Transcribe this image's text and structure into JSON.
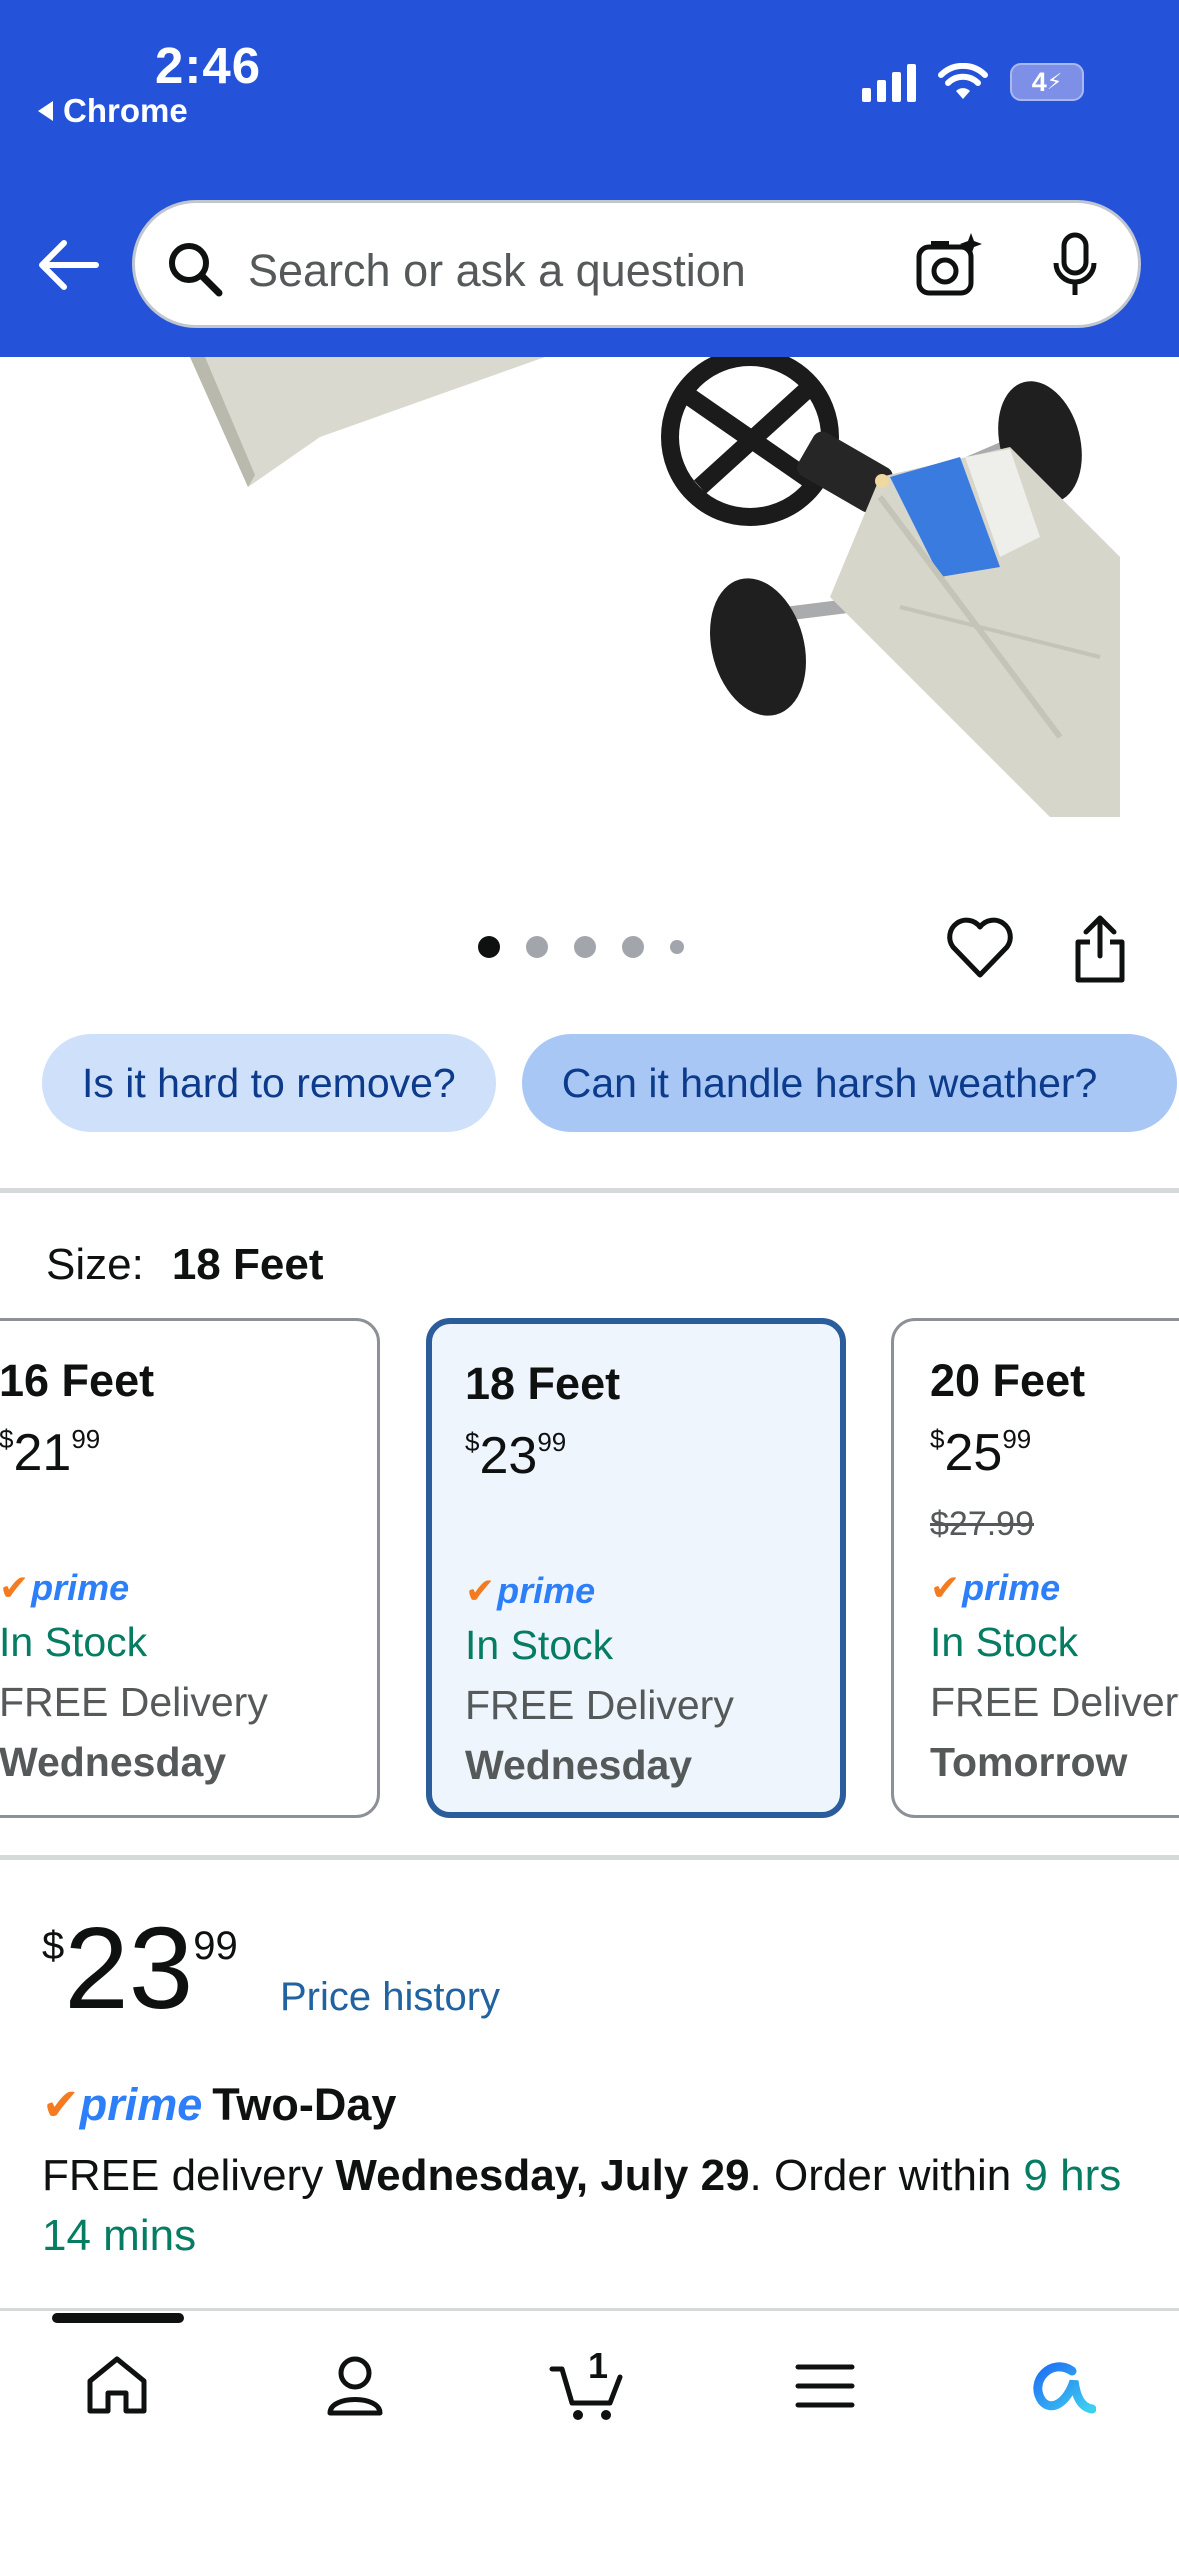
{
  "status_bar": {
    "time": "2:46",
    "back_app": "Chrome",
    "battery": "4"
  },
  "search": {
    "placeholder": "Search or ask a question"
  },
  "carousel": {
    "dot_count": 5,
    "active_index": 0
  },
  "chips": [
    {
      "label": "Is it hard to remove?"
    },
    {
      "label": "Can it handle harsh weather?"
    }
  ],
  "size": {
    "label": "Size:",
    "selected": "18 Feet"
  },
  "size_options": [
    {
      "name": "16 Feet",
      "currency": "$",
      "whole": "21",
      "fraction": "99",
      "list_price": "",
      "prime": "prime",
      "stock": "In Stock",
      "delivery": "FREE Delivery",
      "day": "Wednesday"
    },
    {
      "name": "18 Feet",
      "currency": "$",
      "whole": "23",
      "fraction": "99",
      "list_price": "",
      "prime": "prime",
      "stock": "In Stock",
      "delivery": "FREE Delivery",
      "day": "Wednesday"
    },
    {
      "name": "20 Feet",
      "currency": "$",
      "whole": "25",
      "fraction": "99",
      "list_price": "$27.99",
      "prime": "prime",
      "stock": "In Stock",
      "delivery": "FREE Delivery",
      "day": "Tomorrow"
    }
  ],
  "price": {
    "currency": "$",
    "whole": "23",
    "fraction": "99",
    "history_link": "Price history"
  },
  "prime": {
    "brand": "prime",
    "label": "Two-Day"
  },
  "delivery": {
    "prefix": "FREE delivery ",
    "date": "Wednesday, July 29",
    "middle": ". Order within ",
    "countdown": "9 hrs 14 mins"
  },
  "bottom_nav": {
    "cart_count": "1",
    "items": [
      "home",
      "account",
      "cart",
      "menu",
      "rufus"
    ]
  },
  "colors": {
    "header": "#2453da",
    "link": "#2162a1",
    "stock_green": "#067d62",
    "prime_blue": "#2d7ff9",
    "prime_check": "#f47b20",
    "selected_border": "#2b5c9c"
  }
}
